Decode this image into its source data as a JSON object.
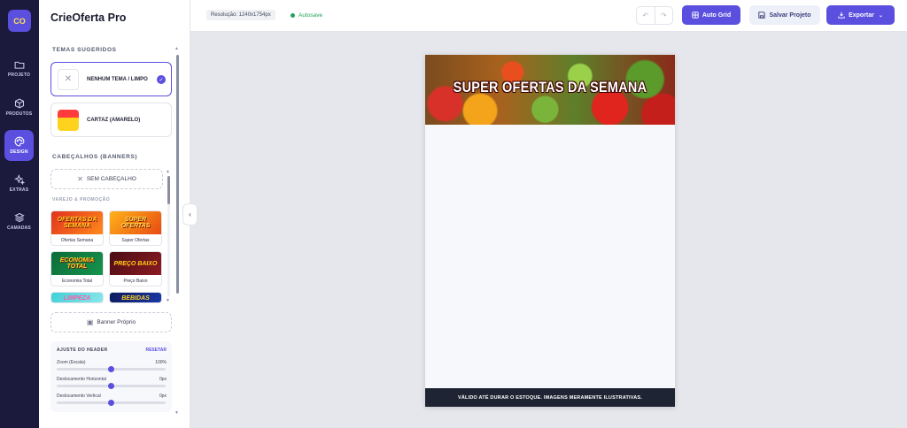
{
  "app": {
    "logo_text": "CO",
    "name": "CrieOferta Pro"
  },
  "rail": {
    "items": [
      {
        "label": "PROJETO",
        "icon": "folder-icon"
      },
      {
        "label": "PRODUTOS",
        "icon": "box-icon"
      },
      {
        "label": "DESIGN",
        "icon": "palette-icon",
        "active": true
      },
      {
        "label": "EXTRAS",
        "icon": "sparkles-icon"
      },
      {
        "label": "CAMADAS",
        "icon": "layers-icon"
      }
    ]
  },
  "panel": {
    "themes_title": "TEMAS SUGERIDOS",
    "themes": [
      {
        "label": "NENHUM TEMA / LIMPO",
        "selected": true
      },
      {
        "label": "CARTAZ (AMARELO)",
        "selected": false
      }
    ],
    "headers_title": "CABEÇALHOS (BANNERS)",
    "no_header_label": "SEM CABEÇALHO",
    "category_label": "VAREJO & PROMOÇÃO",
    "banners": [
      {
        "label": "Ofertas Semana",
        "art": "OFERTAS DA SEMANA"
      },
      {
        "label": "Super Ofertas",
        "art": "SUPER OFERTAS"
      },
      {
        "label": "Economia Total",
        "art": "ECONOMIA TOTAL"
      },
      {
        "label": "Preço Baixo",
        "art": "PREÇO BAIXO"
      },
      {
        "art": "LIMPEZA"
      },
      {
        "art": "BEBIDAS"
      }
    ],
    "own_banner_label": "Banner Próprio",
    "adjust": {
      "title": "AJUSTE DO HEADER",
      "reset_label": "RESETAR",
      "sliders": [
        {
          "label": "Zoom (Escala)",
          "value": "100%"
        },
        {
          "label": "Deslocamento Horizontal",
          "value": "0px"
        },
        {
          "label": "Deslocamento Vertical",
          "value": "0px"
        }
      ]
    }
  },
  "topbar": {
    "resolution": "Resolução: 1240x1754px",
    "autosave": "Autosave",
    "auto_grid_label": "Auto Grid",
    "save_label": "Salvar Projeto",
    "export_label": "Exportar"
  },
  "canvas": {
    "header_title": "SUPER OFERTAS DA SEMANA",
    "footer_text": "VÁLIDO ATÉ DURAR O ESTOQUE. IMAGENS MERAMENTE ILUSTRATIVAS."
  },
  "colors": {
    "accent": "#5b4fe0",
    "rail_bg": "#1c1a3c",
    "success": "#22a35a",
    "footer_bg": "#1e2433"
  }
}
